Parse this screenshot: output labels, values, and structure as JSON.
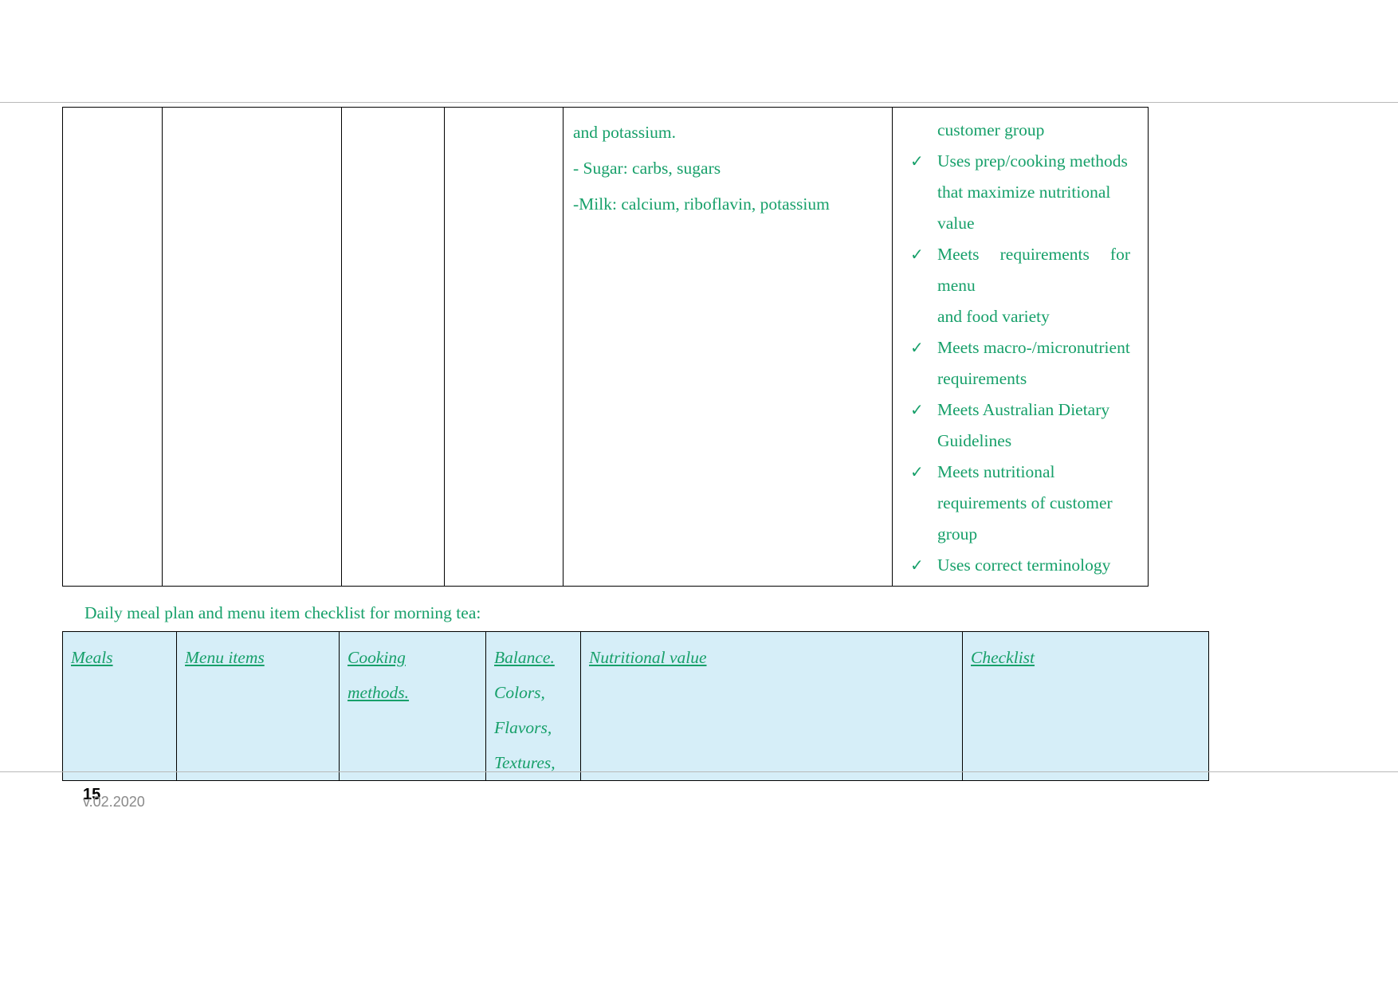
{
  "page": {
    "number": "15",
    "version": "v.02.2020"
  },
  "table1": {
    "nutritional_column": {
      "lines": [
        "and potassium.",
        "- Sugar: carbs, sugars",
        "-Milk: calcium, riboflavin, potassium"
      ]
    },
    "checklist_column": {
      "continuation_line": "customer group",
      "items": [
        {
          "icon": "check-icon",
          "lines": [
            "Uses   prep/cooking   methods",
            "that     maximize     nutritional",
            "value"
          ]
        },
        {
          "icon": "check-icon",
          "lines": [
            "Meets requirements for menu",
            "and food variety"
          ]
        },
        {
          "icon": "check-icon",
          "lines": [
            "Meets   macro-/micronutrient",
            "requirements"
          ]
        },
        {
          "icon": "check-icon",
          "lines": [
            "Meets     Australian     Dietary",
            "Guidelines"
          ]
        },
        {
          "icon": "check-icon",
          "lines": [
            "Meets                   nutritional",
            "requirements     of     customer",
            "group"
          ]
        },
        {
          "icon": "check-icon",
          "lines": [
            "Uses correct terminology"
          ]
        }
      ]
    }
  },
  "caption": "Daily meal plan and menu item checklist for morning tea:",
  "table2": {
    "headers": [
      {
        "label": "Meals",
        "sublines": []
      },
      {
        "label": "Menu items",
        "sublines": []
      },
      {
        "label": "Cooking",
        "sublines": [
          "methods."
        ]
      },
      {
        "label": "Balance.",
        "sublines": [
          "Colors,",
          "Flavors,",
          "Textures,"
        ]
      },
      {
        "label": "Nutritional value",
        "sublines": []
      },
      {
        "label": "Checklist",
        "sublines": []
      }
    ]
  },
  "colors": {
    "text_green": "#17a06a",
    "table2_fill": "#d6eef8",
    "border": "#000000",
    "page_rule": "#b9b9b9"
  }
}
